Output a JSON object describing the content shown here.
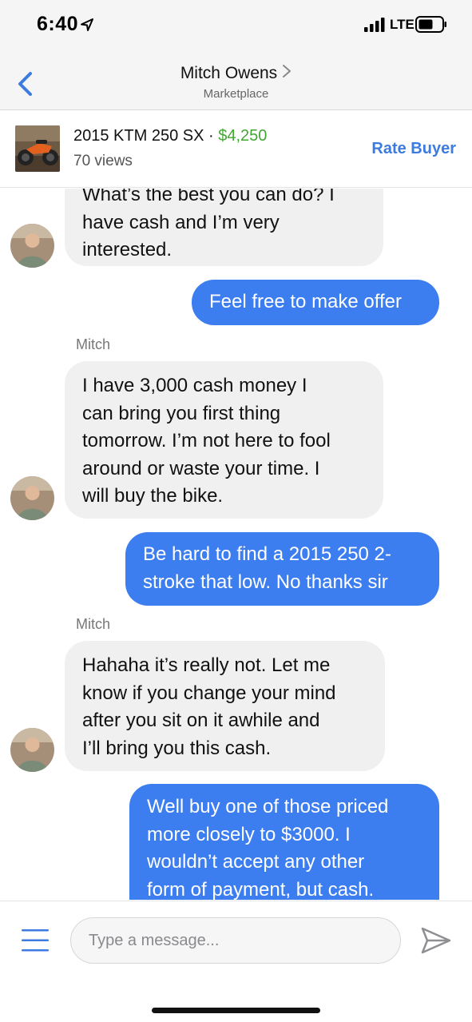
{
  "status_bar": {
    "time": "6:40",
    "network": "LTE"
  },
  "header": {
    "contact_name": "Mitch Owens",
    "subtitle": "Marketplace"
  },
  "listing": {
    "title": "2015 KTM 250 SX",
    "separator": " · ",
    "price": "$4,250",
    "views": "70 views",
    "action_label": "Rate Buyer"
  },
  "messages": [
    {
      "direction": "in",
      "lines": [
        "What’s the best you can do? I",
        "have cash and I’m very",
        "interested."
      ]
    },
    {
      "direction": "out",
      "lines": [
        "Feel free to make offer"
      ]
    },
    {
      "sender": "Mitch"
    },
    {
      "direction": "in",
      "lines": [
        "I have 3,000 cash money I",
        "can bring you first thing",
        "tomorrow. I’m not here to fool",
        "around or waste your time. I",
        "will buy the bike."
      ]
    },
    {
      "direction": "out",
      "lines": [
        "Be hard to find a 2015 250 2-",
        "stroke that low. No thanks sir"
      ]
    },
    {
      "sender": "Mitch"
    },
    {
      "direction": "in",
      "lines": [
        "Hahaha it’s really not. Let me",
        "know if you change your mind",
        "after you sit on it awhile and",
        "I’ll bring you this cash."
      ]
    },
    {
      "direction": "out",
      "lines": [
        "Well buy one of those priced",
        "more closely to $3000. I",
        "wouldn’t accept any other",
        "form of payment, but cash."
      ]
    }
  ],
  "composer": {
    "placeholder": "Type a message..."
  },
  "colors": {
    "accent": "#3c7be0",
    "outgoing_bubble": "#3c7df0",
    "incoming_bubble": "#f0f0f0",
    "price": "#42a632"
  },
  "icons": [
    "location-arrow-icon",
    "signal-icon",
    "battery-icon",
    "back-chevron-icon",
    "chevron-right-icon",
    "menu-icon",
    "send-icon"
  ]
}
